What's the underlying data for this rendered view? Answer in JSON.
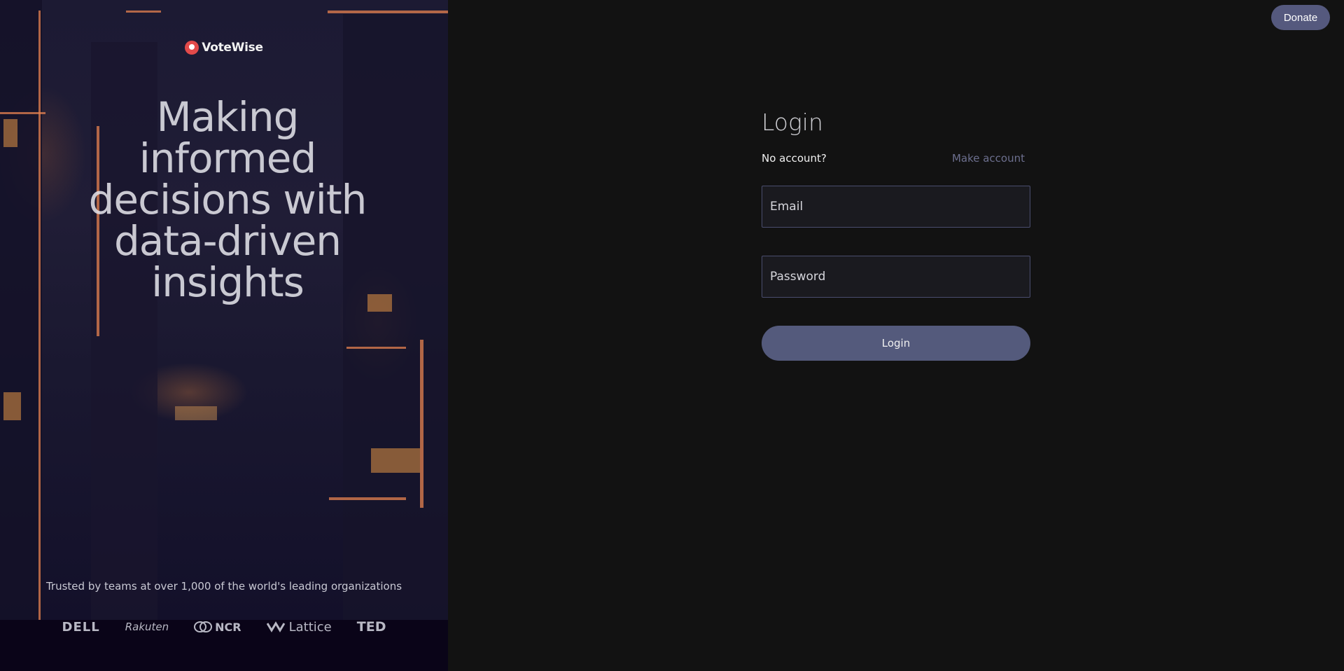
{
  "brand": {
    "name": "VoteWise",
    "icon": "mic-icon"
  },
  "hero": {
    "line1": "Making",
    "line2": "informed",
    "line3": "decisions with",
    "line4": "data-driven",
    "line5": "insights"
  },
  "trusted_text": "Trusted by teams at over 1,000 of the world's leading organizations",
  "partner_logos": [
    "DELL",
    "Rakuten",
    "NCR",
    "Lattice",
    "TED"
  ],
  "header": {
    "donate_label": "Donate"
  },
  "login": {
    "title": "Login",
    "no_account": "No account?",
    "make_account": "Make account",
    "email_placeholder": "Email",
    "password_placeholder": "Password",
    "submit_label": "Login"
  },
  "colors": {
    "background": "#121212",
    "accent": "#545a7c",
    "link": "#6c6f8e",
    "brand_red": "#e24a4a"
  }
}
